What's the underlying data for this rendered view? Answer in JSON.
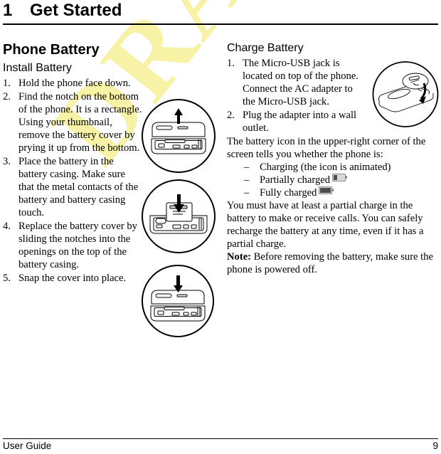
{
  "document": {
    "chapter_number": "1",
    "chapter_title": "Get Started"
  },
  "left_column": {
    "section_heading": "Phone Battery",
    "subsection_heading": "Install Battery",
    "steps": [
      {
        "marker": "1.",
        "text": "Hold the phone face down."
      },
      {
        "marker": "2.",
        "text": "Find the notch on the bottom of the phone. It is a rectangle. Using your thumbnail, remove the battery cover by prying it up from the bottom."
      },
      {
        "marker": "3.",
        "text": "Place the battery in the battery casing. Make sure that the metal contacts of the battery and battery casing touch."
      },
      {
        "marker": "4.",
        "text": "Replace the battery cover by sliding the notches into the openings on the top of the battery casing."
      },
      {
        "marker": "5.",
        "text": "Snap the cover into place."
      }
    ],
    "figures": [
      {
        "name": "remove-cover-illustration",
        "caption": ""
      },
      {
        "name": "insert-battery-illustration",
        "caption": ""
      },
      {
        "name": "snap-cover-illustration",
        "caption": ""
      }
    ]
  },
  "right_column": {
    "section_heading": "Charge Battery",
    "steps": [
      {
        "marker": "1.",
        "text": "The Micro-USB jack is located on top of the phone. Connect the AC adapter to the Micro-USB jack."
      },
      {
        "marker": "2.",
        "text": "Plug the adapter into a wall outlet."
      }
    ],
    "intro_paragraph": "The battery icon in the upper-right corner of the screen tells you whether the phone is:",
    "status_items": [
      {
        "dash": "–",
        "text": "Charging (the icon is animated)",
        "icon": "none"
      },
      {
        "dash": "–",
        "text": "Partially charged",
        "icon": "battery-partial-icon"
      },
      {
        "dash": "–",
        "text": "Fully charged",
        "icon": "battery-full-icon"
      }
    ],
    "body_paragraph": "You must have at least a partial charge in the battery to make or receive calls. You can safely recharge the battery at any time, even if it has a partial charge.",
    "note_label": "Note:",
    "note_text": " Before removing the battery, make sure the phone is powered off.",
    "figure": {
      "name": "micro-usb-jack-illustration",
      "caption": ""
    }
  },
  "watermark": {
    "text": "DRAFT",
    "color": "#f7f2a6"
  },
  "footer": {
    "left_label": "User Guide",
    "page_number": "9"
  },
  "colors": {
    "text": "#000000",
    "page_background": "#ffffff",
    "rule": "#000000",
    "watermark": "#f7f2a6",
    "icon_gray": "#8d8d8d"
  }
}
